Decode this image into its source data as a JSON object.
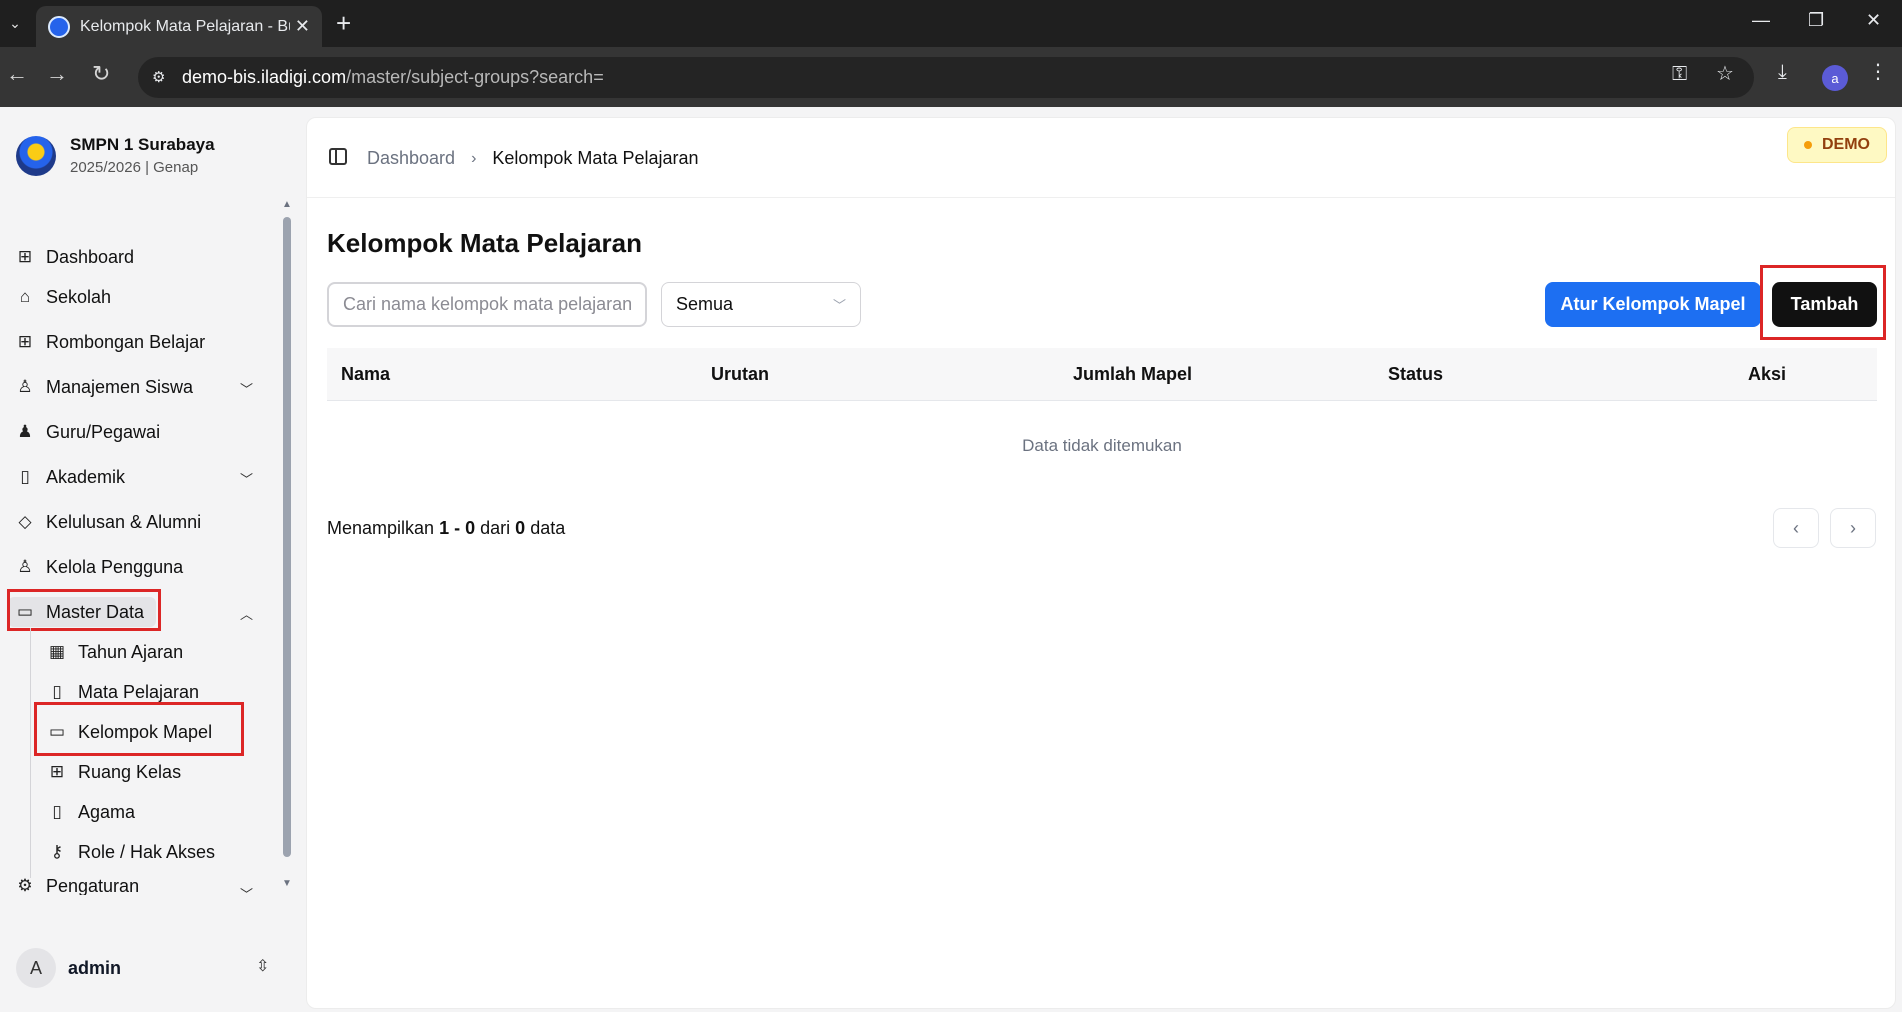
{
  "browser": {
    "tab_title": "Kelompok Mata Pelajaran - Buku",
    "url_host": "demo-bis.iladigi.com",
    "url_path": "/master/subject-groups?search=",
    "profile_initial": "a"
  },
  "school": {
    "name": "SMPN 1 Surabaya",
    "period": "2025/2026 | Genap"
  },
  "sidebar": {
    "items": [
      {
        "label": "Dashboard",
        "icon": "grid-icon"
      },
      {
        "label": "Sekolah",
        "icon": "school-icon"
      },
      {
        "label": "Rombongan Belajar",
        "icon": "grid-icon"
      },
      {
        "label": "Manajemen Siswa",
        "icon": "user-icon"
      },
      {
        "label": "Guru/Pegawai",
        "icon": "users-icon"
      },
      {
        "label": "Akademik",
        "icon": "book-icon"
      },
      {
        "label": "Kelulusan & Alumni",
        "icon": "graduation-icon"
      },
      {
        "label": "Kelola Pengguna",
        "icon": "user-cog-icon"
      },
      {
        "label": "Master Data",
        "icon": "folder-icon"
      },
      {
        "label": "Pengaturan",
        "icon": "settings-icon"
      }
    ],
    "sub_items": [
      {
        "label": "Tahun Ajaran",
        "icon": "calendar-icon"
      },
      {
        "label": "Mata Pelajaran",
        "icon": "book-icon"
      },
      {
        "label": "Kelompok Mapel",
        "icon": "folder-icon"
      },
      {
        "label": "Ruang Kelas",
        "icon": "grid-icon"
      },
      {
        "label": "Agama",
        "icon": "book-icon"
      },
      {
        "label": "Role / Hak Akses",
        "icon": "key-icon"
      }
    ],
    "user": {
      "initial": "A",
      "name": "admin"
    }
  },
  "header": {
    "breadcrumb": [
      "Dashboard",
      "Kelompok Mata Pelajaran"
    ],
    "badge": "DEMO"
  },
  "main": {
    "title": "Kelompok Mata Pelajaran",
    "search_placeholder": "Cari nama kelompok mata pelajaran",
    "filter_value": "Semua",
    "btn_manage": "Atur Kelompok Mapel",
    "btn_add": "Tambah",
    "columns": [
      "Nama",
      "Urutan",
      "Jumlah Mapel",
      "Status",
      "Aksi"
    ],
    "empty_text": "Data tidak ditemukan",
    "summary": {
      "prefix": "Menampilkan",
      "range": "1 - 0",
      "mid": "dari",
      "total": "0",
      "suffix": "data"
    }
  }
}
